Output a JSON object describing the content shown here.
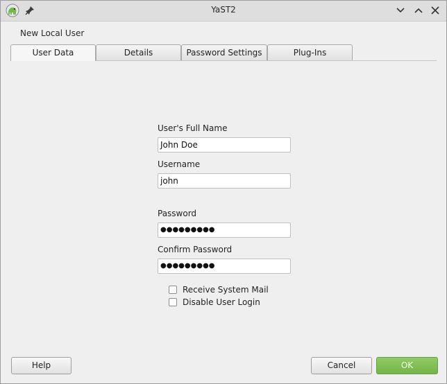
{
  "window": {
    "title": "YaST2",
    "icons": {
      "app": "yast-chameleon-icon",
      "pin": "pin-icon",
      "minimize": "chevron-down-icon",
      "maximize": "chevron-up-icon",
      "close": "close-icon"
    }
  },
  "dialog": {
    "heading": "New Local User"
  },
  "tabs": [
    {
      "label": "User Data",
      "active": true
    },
    {
      "label": "Details",
      "active": false
    },
    {
      "label": "Password Settings",
      "active": false
    },
    {
      "label": "Plug-Ins",
      "active": false
    }
  ],
  "form": {
    "full_name": {
      "label": "User's Full Name",
      "value": "John Doe"
    },
    "username": {
      "label": "Username",
      "value": "john"
    },
    "password": {
      "label": "Password",
      "value": "●●●●●●●●●"
    },
    "confirm_password": {
      "label": "Confirm Password",
      "value": "●●●●●●●●●"
    },
    "receive_system_mail": {
      "label": "Receive System Mail",
      "checked": false
    },
    "disable_user_login": {
      "label": "Disable User Login",
      "checked": false
    }
  },
  "buttons": {
    "help": "Help",
    "cancel": "Cancel",
    "ok": "OK"
  },
  "colors": {
    "ok_button": "#7dbd52",
    "window_background": "#efefef",
    "titlebar": "#dedede"
  }
}
